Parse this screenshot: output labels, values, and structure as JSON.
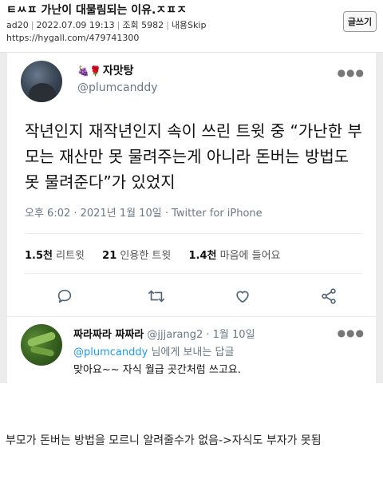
{
  "post": {
    "title": "ㅌㅆㅍ 가난이 대물림되는 이유.ㅈㅍㅈ",
    "author": "ad20",
    "date": "2022.07.09 19:13",
    "views": "조회 5982",
    "skip": "내용Skip",
    "url": "https://hygall.com/479741300",
    "write_label": "글쓰기"
  },
  "tweet": {
    "author_name": "자맛탕",
    "author_emojis": "🍇🌹",
    "handle": "@plumcanddy",
    "text": "작년인지 재작년인지 속이 쓰린 트윗 중 “가난한 부모는 재산만 못 물려주는게 아니라 돈버는 방법도 못 물려준다”가 있었지",
    "time": "오후 6:02 · 2021년 1월 10일 · Twitter for iPhone",
    "retweets_count": "1.5천",
    "retweets_label": "리트윗",
    "quotes_count": "21",
    "quotes_label": "인용한 트윗",
    "likes_count": "1.4천",
    "likes_label": "마음에 들어요",
    "actions": [
      "reply-icon",
      "retweet-icon",
      "like-icon",
      "share-icon"
    ]
  },
  "reply": {
    "name": "짜라짜라 짜짜라",
    "handle_time": "@jjjarang2 · 1월 10일",
    "replying_to_mention": "@plumcanddy",
    "replying_to_suffix": " 님에게 보내는 답글",
    "text": "맞아요~~ 자식 월급 곳간처럼 쓰고요."
  },
  "comment": "부모가 돈버는 방법을 모르니 알려줄수가 없음->자식도 부자가 못됨",
  "colors": {
    "link": "#1d9bf0",
    "muted": "#6a7884",
    "icon": "#536471",
    "background_gap": "#ececec"
  }
}
